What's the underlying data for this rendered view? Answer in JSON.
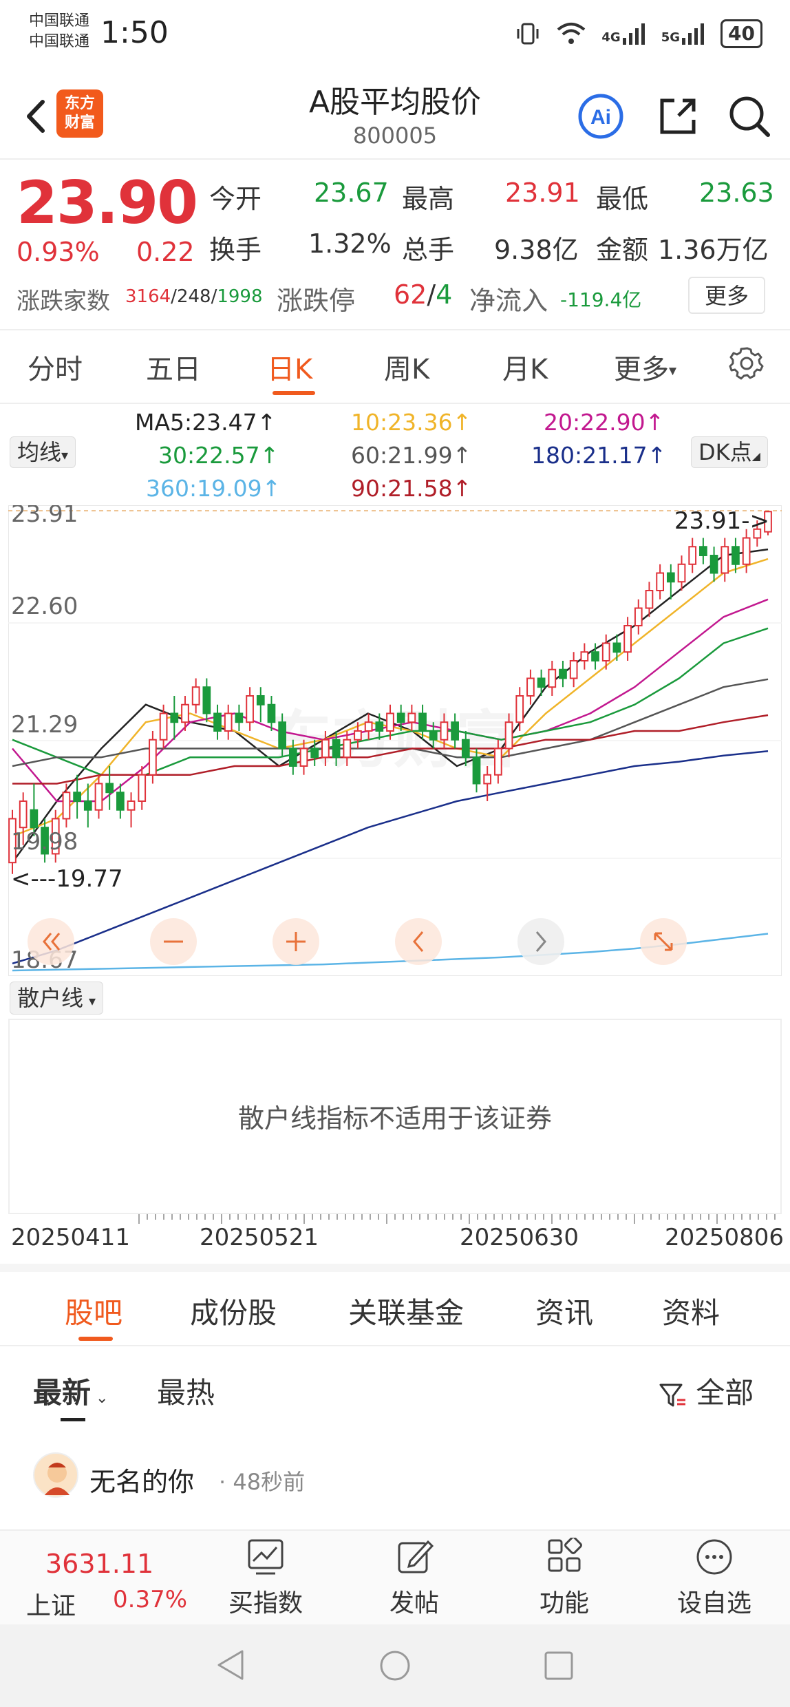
{
  "status_bar": {
    "carrier_1": "中国联通",
    "carrier_2": "中国联通",
    "time": "1:50",
    "net_4g": "4G",
    "net_5g": "5G",
    "battery": "40"
  },
  "header": {
    "logo_line1": "东方",
    "logo_line2": "财富",
    "title": "A股平均股价",
    "code": "800005",
    "icons": [
      "back-icon",
      "ai-icon",
      "share-icon",
      "search-icon"
    ]
  },
  "quote": {
    "price": "23.90",
    "change_pct": "0.93%",
    "change": "0.22",
    "open_label": "今开",
    "open": "23.67",
    "high_label": "最高",
    "high": "23.91",
    "low_label": "最低",
    "low": "23.63",
    "turnover_label": "换手",
    "turnover": "1.32%",
    "volume_label": "总手",
    "volume": "9.38亿",
    "amount_label": "金额",
    "amount": "1.36万亿",
    "breadth_label": "涨跌家数",
    "breadth_up": "3164",
    "breadth_sep1": "/",
    "breadth_flat": "248",
    "breadth_sep2": "/",
    "breadth_down": "1998",
    "limit_label": "涨跌停",
    "limit_up": "62",
    "limit_sep": "/",
    "limit_down": "4",
    "netflow_label": "净流入",
    "netflow": "-119.4亿",
    "more_button": "更多"
  },
  "period_tabs": [
    "分时",
    "五日",
    "日K",
    "周K",
    "月K",
    "更多"
  ],
  "period_active": "日K",
  "ma_selector": "均线",
  "dk_button": "DK点",
  "ma_legend": [
    {
      "text": "MA5:23.47↑",
      "color": "#222222"
    },
    {
      "text": "10:23.36↑",
      "color": "#f0b429"
    },
    {
      "text": "20:22.90↑",
      "color": "#c2188f"
    },
    {
      "text": "30:22.57↑",
      "color": "#1a9a3c"
    },
    {
      "text": "60:21.99↑",
      "color": "#555555"
    },
    {
      "text": "180:21.17↑",
      "color": "#1a2f8a"
    },
    {
      "text": "360:19.09↑",
      "color": "#5bb4e6"
    },
    {
      "text": "90:21.58↑",
      "color": "#b01e28"
    }
  ],
  "chart": {
    "y_labels": [
      "23.91",
      "22.60",
      "21.29",
      "19.98",
      "18.67"
    ],
    "max_marker": "23.91->",
    "min_marker": "<---19.77",
    "watermark": "东方财富",
    "controls": [
      "double-left-icon",
      "zoom-out-icon",
      "zoom-in-icon",
      "left-icon",
      "right-icon",
      "fullscreen-icon"
    ]
  },
  "chart_data": {
    "type": "candlestick",
    "ylim": [
      18.67,
      23.91
    ],
    "x_labels": [
      "20250411",
      "20250521",
      "20250630",
      "20250806"
    ],
    "candles": [
      [
        19.9,
        20.4,
        19.77,
        20.5
      ],
      [
        20.3,
        20.6,
        20.1,
        20.7
      ],
      [
        20.5,
        20.3,
        20.2,
        20.8
      ],
      [
        20.3,
        20.0,
        19.9,
        20.4
      ],
      [
        20.0,
        20.4,
        19.9,
        20.5
      ],
      [
        20.4,
        20.7,
        20.3,
        20.8
      ],
      [
        20.7,
        20.6,
        20.4,
        20.9
      ],
      [
        20.6,
        20.5,
        20.3,
        20.8
      ],
      [
        20.5,
        20.8,
        20.4,
        20.9
      ],
      [
        20.8,
        20.7,
        20.5,
        21.0
      ],
      [
        20.7,
        20.5,
        20.4,
        20.8
      ],
      [
        20.5,
        20.6,
        20.3,
        20.7
      ],
      [
        20.6,
        20.9,
        20.5,
        21.0
      ],
      [
        20.9,
        21.3,
        20.8,
        21.4
      ],
      [
        21.3,
        21.6,
        21.2,
        21.7
      ],
      [
        21.6,
        21.5,
        21.3,
        21.8
      ],
      [
        21.5,
        21.7,
        21.4,
        21.8
      ],
      [
        21.7,
        21.9,
        21.6,
        22.0
      ],
      [
        21.9,
        21.6,
        21.5,
        22.0
      ],
      [
        21.6,
        21.4,
        21.3,
        21.7
      ],
      [
        21.4,
        21.6,
        21.3,
        21.7
      ],
      [
        21.6,
        21.5,
        21.4,
        21.7
      ],
      [
        21.5,
        21.8,
        21.4,
        21.9
      ],
      [
        21.8,
        21.7,
        21.5,
        21.9
      ],
      [
        21.7,
        21.5,
        21.4,
        21.8
      ],
      [
        21.5,
        21.2,
        21.1,
        21.6
      ],
      [
        21.2,
        21.0,
        20.9,
        21.3
      ],
      [
        21.0,
        21.2,
        20.9,
        21.3
      ],
      [
        21.2,
        21.1,
        21.0,
        21.3
      ],
      [
        21.1,
        21.3,
        21.0,
        21.4
      ],
      [
        21.3,
        21.1,
        21.0,
        21.4
      ],
      [
        21.1,
        21.3,
        21.0,
        21.4
      ],
      [
        21.3,
        21.4,
        21.2,
        21.5
      ],
      [
        21.4,
        21.5,
        21.3,
        21.6
      ],
      [
        21.5,
        21.4,
        21.3,
        21.6
      ],
      [
        21.4,
        21.6,
        21.3,
        21.7
      ],
      [
        21.6,
        21.5,
        21.4,
        21.7
      ],
      [
        21.5,
        21.6,
        21.4,
        21.7
      ],
      [
        21.6,
        21.4,
        21.3,
        21.7
      ],
      [
        21.4,
        21.3,
        21.2,
        21.5
      ],
      [
        21.3,
        21.5,
        21.2,
        21.6
      ],
      [
        21.5,
        21.3,
        21.2,
        21.6
      ],
      [
        21.3,
        21.1,
        21.0,
        21.4
      ],
      [
        21.1,
        20.8,
        20.7,
        21.2
      ],
      [
        20.8,
        20.9,
        20.6,
        21.0
      ],
      [
        20.9,
        21.2,
        20.8,
        21.3
      ],
      [
        21.2,
        21.5,
        21.1,
        21.6
      ],
      [
        21.5,
        21.8,
        21.4,
        21.9
      ],
      [
        21.8,
        22.0,
        21.7,
        22.1
      ],
      [
        22.0,
        21.9,
        21.8,
        22.1
      ],
      [
        21.9,
        22.1,
        21.8,
        22.2
      ],
      [
        22.1,
        22.0,
        21.9,
        22.2
      ],
      [
        22.0,
        22.2,
        21.9,
        22.3
      ],
      [
        22.2,
        22.3,
        22.1,
        22.4
      ],
      [
        22.3,
        22.2,
        22.1,
        22.4
      ],
      [
        22.2,
        22.4,
        22.1,
        22.5
      ],
      [
        22.4,
        22.3,
        22.2,
        22.5
      ],
      [
        22.3,
        22.6,
        22.2,
        22.7
      ],
      [
        22.6,
        22.8,
        22.5,
        22.9
      ],
      [
        22.8,
        23.0,
        22.7,
        23.1
      ],
      [
        23.0,
        23.2,
        22.9,
        23.3
      ],
      [
        23.2,
        23.1,
        22.9,
        23.3
      ],
      [
        23.1,
        23.3,
        23.0,
        23.4
      ],
      [
        23.3,
        23.5,
        23.2,
        23.6
      ],
      [
        23.5,
        23.4,
        23.3,
        23.6
      ],
      [
        23.4,
        23.2,
        23.1,
        23.5
      ],
      [
        23.2,
        23.5,
        23.1,
        23.6
      ],
      [
        23.5,
        23.3,
        23.2,
        23.6
      ],
      [
        23.3,
        23.6,
        23.2,
        23.7
      ],
      [
        23.6,
        23.7,
        23.5,
        23.8
      ],
      [
        23.67,
        23.9,
        23.63,
        23.91
      ]
    ],
    "ma_series": [
      {
        "name": "MA5",
        "color": "#222222",
        "values": [
          19.9,
          20.6,
          21.2,
          21.7,
          21.5,
          21.4,
          21.0,
          21.3,
          21.6,
          21.4,
          21.0,
          21.2,
          21.9,
          22.3,
          22.6,
          23.0,
          23.4,
          23.47
        ]
      },
      {
        "name": "MA10",
        "color": "#f0b429",
        "values": [
          20.2,
          20.4,
          20.9,
          21.5,
          21.6,
          21.4,
          21.2,
          21.3,
          21.5,
          21.4,
          21.2,
          21.1,
          21.6,
          22.0,
          22.4,
          22.8,
          23.2,
          23.36
        ]
      },
      {
        "name": "MA20",
        "color": "#c2188f",
        "values": [
          21.2,
          20.6,
          20.6,
          21.0,
          21.5,
          21.6,
          21.4,
          21.3,
          21.4,
          21.5,
          21.4,
          21.3,
          21.4,
          21.6,
          21.9,
          22.3,
          22.7,
          22.9
        ]
      },
      {
        "name": "MA30",
        "color": "#1a9a3c",
        "values": [
          21.3,
          21.1,
          20.9,
          20.9,
          21.1,
          21.1,
          21.1,
          21.2,
          21.3,
          21.4,
          21.4,
          21.3,
          21.4,
          21.5,
          21.7,
          22.0,
          22.4,
          22.57
        ]
      },
      {
        "name": "MA60",
        "color": "#555555",
        "values": [
          21.0,
          21.1,
          21.1,
          21.2,
          21.2,
          21.2,
          21.2,
          21.2,
          21.2,
          21.2,
          21.1,
          21.1,
          21.2,
          21.3,
          21.5,
          21.7,
          21.9,
          21.99
        ]
      },
      {
        "name": "MA90",
        "color": "#b01e28",
        "values": [
          20.8,
          20.8,
          20.9,
          20.9,
          20.9,
          21.0,
          21.0,
          21.1,
          21.1,
          21.2,
          21.2,
          21.2,
          21.3,
          21.3,
          21.4,
          21.4,
          21.5,
          21.58
        ]
      },
      {
        "name": "MA180",
        "color": "#1a2f8a",
        "values": [
          18.75,
          18.9,
          19.1,
          19.3,
          19.5,
          19.7,
          19.9,
          20.1,
          20.3,
          20.45,
          20.6,
          20.7,
          20.8,
          20.9,
          21.0,
          21.05,
          21.12,
          21.17
        ]
      },
      {
        "name": "MA360",
        "color": "#5bb4e6",
        "values": [
          18.67,
          18.68,
          18.69,
          18.7,
          18.71,
          18.72,
          18.73,
          18.74,
          18.76,
          18.78,
          18.8,
          18.82,
          18.85,
          18.88,
          18.92,
          18.97,
          19.03,
          19.09
        ]
      }
    ]
  },
  "sub_indicator": {
    "selector": "散户线",
    "message": "散户线指标不适用于该证券"
  },
  "content_tabs": [
    "股吧",
    "成份股",
    "关联基金",
    "资讯",
    "资料"
  ],
  "content_active": "股吧",
  "sort_tabs": {
    "latest": "最新",
    "hot": "最热",
    "filter": "全部"
  },
  "post": {
    "user": "无名的你",
    "time": "· 48秒前"
  },
  "bottom_bar": {
    "index_name": "上证",
    "index_value": "3631.11",
    "index_change": "0.37%",
    "items": [
      {
        "label": "买指数",
        "icon": "trend-chart-icon"
      },
      {
        "label": "发帖",
        "icon": "edit-icon"
      },
      {
        "label": "功能",
        "icon": "grid-icon"
      },
      {
        "label": "设自选",
        "icon": "more-circle-icon"
      }
    ]
  },
  "nav_bar": {
    "icons": [
      "back-triangle-icon",
      "home-circle-icon",
      "recent-square-icon"
    ]
  }
}
